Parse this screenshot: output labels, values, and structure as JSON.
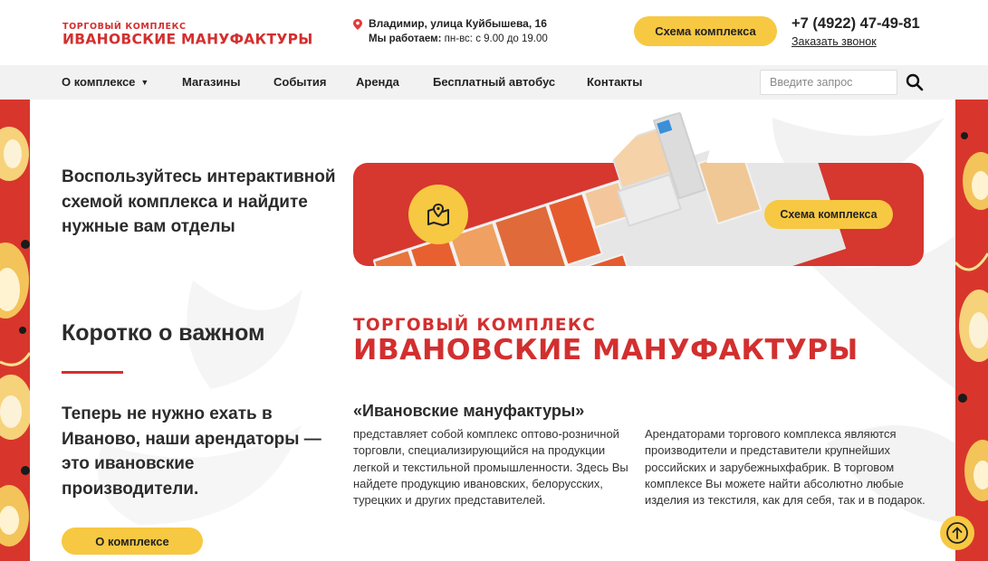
{
  "header": {
    "logo_top": "ТОРГОВЫЙ КОМПЛЕКС",
    "logo_bottom": "ИВАНОВСКИЕ МАНУФАКТУРЫ",
    "address": "Владимир, улица Куйбышева, 16",
    "hours_label": "Мы работаем:",
    "hours_value": " пн-вс: с 9.00 до 19.00",
    "scheme_button": "Схема комплекса",
    "phone": "+7 (4922) 47-49-81",
    "callback_link": "Заказать звонок"
  },
  "nav": {
    "items": [
      {
        "label": "О комплексе"
      },
      {
        "label": "Магазины"
      },
      {
        "label": "События"
      },
      {
        "label": "Аренда"
      },
      {
        "label": "Бесплатный автобус"
      },
      {
        "label": "Контакты"
      }
    ],
    "search_placeholder": "Введите запрос",
    "icons": {
      "dropdown": "triangle-down-icon",
      "search": "search-icon"
    }
  },
  "promo": {
    "text": "Воспользуйтесь интерактивной схемой комплекса и найдите нужные вам отделы",
    "banner_button": "Схема комплекса",
    "banner_icon": "map-pin-icon"
  },
  "about": {
    "title": "Коротко о важном",
    "lead": "Теперь не нужно ехать в Иваново, наши арендаторы — это ивановские производители.",
    "button": "О комплексе",
    "logo_top": "ТОРГОВЫЙ КОМПЛЕКС",
    "logo_bottom": "ИВАНОВСКИЕ МАНУФАКТУРЫ",
    "col_title": "«Ивановские мануфактуры»",
    "col1_text": "представляет собой комплекс оптово-розничной торговли, специализирующийся на продукции легкой и текстильной промышленности. Здесь Вы найдете продукцию ивановских, белорусских, турецких и других представителей.",
    "col2_text": "Арендаторами торгового комплекса являются производители и представители крупнейших российских и зарубежныхфабрик. В торговом комплексе Вы можете найти абсолютно любые изделия из текстиля, как для себя, так и в подарок."
  },
  "scroll_top_icon": "arrow-up-icon",
  "colors": {
    "brand_red": "#d32f2f",
    "accent_yellow": "#f7c842",
    "nav_bg": "#f2f2f2",
    "banner_red": "#d6372f"
  }
}
